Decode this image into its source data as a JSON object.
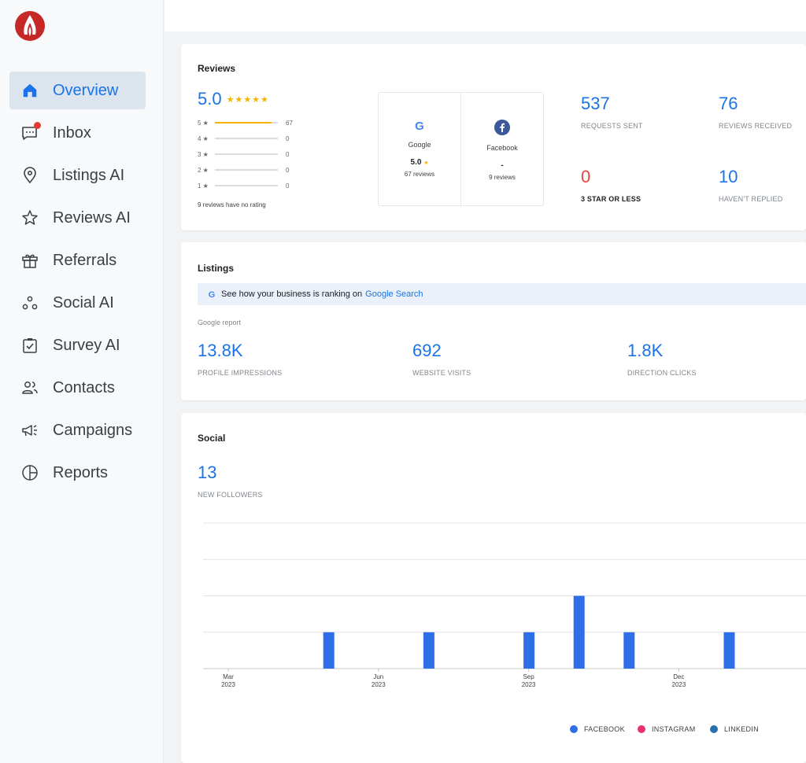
{
  "sidebar": {
    "items": [
      {
        "label": "Overview",
        "icon": "home-icon"
      },
      {
        "label": "Inbox",
        "icon": "chat-icon"
      },
      {
        "label": "Listings AI",
        "icon": "location-pin-icon"
      },
      {
        "label": "Reviews AI",
        "icon": "star-icon"
      },
      {
        "label": "Referrals",
        "icon": "gift-icon"
      },
      {
        "label": "Social AI",
        "icon": "social-nodes-icon"
      },
      {
        "label": "Survey AI",
        "icon": "clipboard-check-icon"
      },
      {
        "label": "Contacts",
        "icon": "contacts-icon"
      },
      {
        "label": "Campaigns",
        "icon": "megaphone-icon"
      },
      {
        "label": "Reports",
        "icon": "pie-chart-icon"
      }
    ]
  },
  "reviews": {
    "title": "Reviews",
    "rating": "5.0",
    "stars": "★★★★★",
    "distribution": [
      {
        "label": "5 ★",
        "count": "67",
        "fraction": 0.9
      },
      {
        "label": "4 ★",
        "count": "0",
        "fraction": 0
      },
      {
        "label": "3 ★",
        "count": "0",
        "fraction": 0
      },
      {
        "label": "2 ★",
        "count": "0",
        "fraction": 0
      },
      {
        "label": "1 ★",
        "count": "0",
        "fraction": 0
      }
    ],
    "no_rating": "9 reviews have no rating",
    "sources": [
      {
        "name": "Google",
        "rating": "5.0",
        "star": "★",
        "reviews": "67 reviews"
      },
      {
        "name": "Facebook",
        "rating": "-",
        "star": "",
        "reviews": "9 reviews"
      }
    ],
    "stats": [
      {
        "value": "537",
        "caption": "REQUESTS SENT"
      },
      {
        "value": "76",
        "caption": "REVIEWS RECEIVED"
      },
      {
        "value": "0",
        "caption": "3 STAR OR LESS"
      },
      {
        "value": "10",
        "caption": "HAVEN'T REPLIED"
      }
    ]
  },
  "listings": {
    "title": "Listings",
    "banner_text": "See how your business is ranking on",
    "banner_link": "Google Search",
    "report_label": "Google report",
    "stats": [
      {
        "value": "13.8K",
        "caption": "PROFILE IMPRESSIONS"
      },
      {
        "value": "692",
        "caption": "WEBSITE VISITS"
      },
      {
        "value": "1.8K",
        "caption": "DIRECTION CLICKS"
      }
    ]
  },
  "social": {
    "title": "Social",
    "followers": "13",
    "followers_caption": "NEW FOLLOWERS",
    "legend": [
      {
        "label": "FACEBOOK",
        "color": "#2e6ee8"
      },
      {
        "label": "INSTAGRAM",
        "color": "#e8336d"
      },
      {
        "label": "LINKEDIN",
        "color": "#2c6fad"
      }
    ]
  },
  "chart_data": {
    "type": "bar",
    "x_tick_labels": [
      {
        "month": "Mar",
        "year": "2023"
      },
      {
        "month": "Jun",
        "year": "2023"
      },
      {
        "month": "Sep",
        "year": "2023"
      },
      {
        "month": "Dec",
        "year": "2023"
      }
    ],
    "series": [
      {
        "name": "FACEBOOK",
        "points": [
          {
            "x": "2023-05",
            "y": 1
          },
          {
            "x": "2023-07",
            "y": 1
          },
          {
            "x": "2023-09",
            "y": 1
          },
          {
            "x": "2023-10",
            "y": 2
          },
          {
            "x": "2023-11",
            "y": 1
          },
          {
            "x": "2024-01",
            "y": 1
          }
        ]
      },
      {
        "name": "INSTAGRAM",
        "points": []
      },
      {
        "name": "LINKEDIN",
        "points": []
      }
    ],
    "ylim": [
      0,
      4
    ],
    "grid": true,
    "legend_position": "bottom"
  }
}
